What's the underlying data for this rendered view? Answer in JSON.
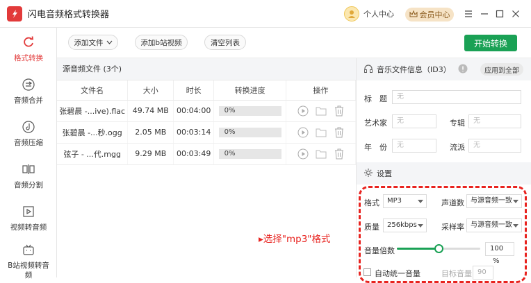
{
  "app": {
    "title": "闪电音频格式转换器"
  },
  "header": {
    "user_label": "个人中心",
    "vip_label": "会员中心"
  },
  "sidebar": {
    "items": [
      {
        "label": "格式转换",
        "icon": "refresh-icon"
      },
      {
        "label": "音频合并",
        "icon": "merge-icon"
      },
      {
        "label": "音频压缩",
        "icon": "compress-icon"
      },
      {
        "label": "音频分割",
        "icon": "split-icon"
      },
      {
        "label": "视频转音频",
        "icon": "video-icon"
      },
      {
        "label": "B站视频转音频",
        "icon": "bilibili-icon"
      }
    ]
  },
  "toolbar": {
    "add_file": "添加文件",
    "add_bili": "添加b站视频",
    "clear": "清空列表",
    "start": "开始转换"
  },
  "files": {
    "header": "源音频文件 (3个)",
    "columns": [
      "文件名",
      "大小",
      "时长",
      "转换进度",
      "操作"
    ],
    "rows": [
      {
        "name": "张碧晨 -...ive).flac",
        "size": "49.74 MB",
        "duration": "00:04:00",
        "progress": "0%"
      },
      {
        "name": "张碧晨 -...秒.ogg",
        "size": "2.05 MB",
        "duration": "00:03:14",
        "progress": "0%"
      },
      {
        "name": "弦子 - ...代.mgg",
        "size": "9.29 MB",
        "duration": "00:03:49",
        "progress": "0%"
      }
    ]
  },
  "annotation": "▸选择\"mp3\"格式",
  "id3": {
    "title": "音乐文件信息（ID3）",
    "apply_all": "应用到全部",
    "fields": {
      "title_label": "标　题",
      "title_ph": "无",
      "artist_label": "艺术家",
      "artist_ph": "无",
      "album_label": "专辑",
      "album_ph": "无",
      "year_label": "年　份",
      "year_ph": "无",
      "genre_label": "流派",
      "genre_ph": "无"
    }
  },
  "settings": {
    "title": "设置",
    "format_label": "格式",
    "format_value": "MP3",
    "channel_label": "声道数",
    "channel_value": "与源音频一致",
    "quality_label": "质量",
    "quality_value": "256kbps",
    "samplerate_label": "采样率",
    "samplerate_value": "与源音频一致",
    "volume_label": "音量倍数",
    "volume_value": "100",
    "volume_unit": "%",
    "volume_level": 0.5,
    "auto_volume_label": "自动统一音量",
    "target_volume_label": "目标音量",
    "target_volume_value": "90"
  },
  "colors": {
    "accent": "#e23a3a",
    "primary": "#1aa155",
    "annotation": "#e8231f"
  }
}
